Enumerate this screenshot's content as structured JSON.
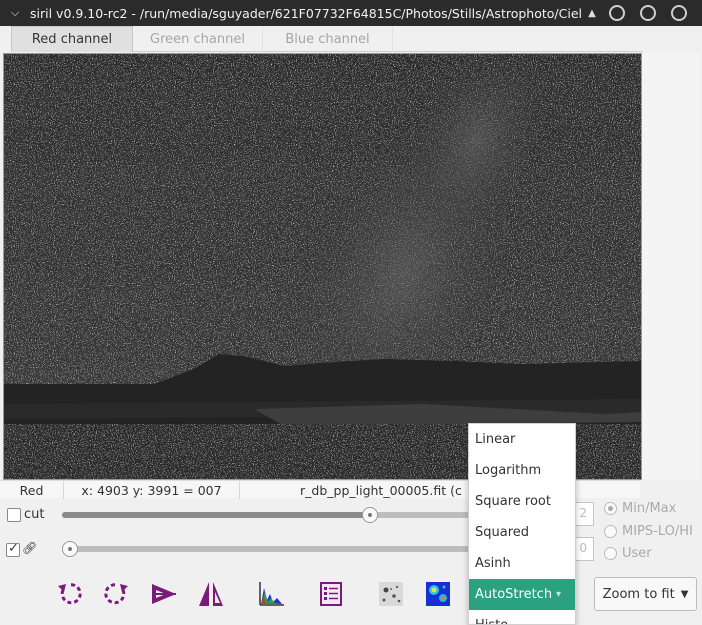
{
  "window": {
    "title": "siril v0.9.10-rc2 - /run/media/sguyader/621F07732F64815C/Photos/Stills/Astrophoto/Ciel_",
    "menu_icon": "chevron-down-icon",
    "up_icon": "chevron-up-icon"
  },
  "tabs": [
    {
      "label": "Red channel",
      "active": true
    },
    {
      "label": "Green channel",
      "active": false
    },
    {
      "label": "Blue channel",
      "active": false
    }
  ],
  "statusbar": {
    "channel": "Red",
    "coords": "x: 4903 y: 3991 = 007",
    "filename": "r_db_pp_light_00005.fit (c"
  },
  "levels_row": {
    "cut_checked": false,
    "cut_label": "cut",
    "hi_value": "2",
    "hi_slider_fraction": 0.67
  },
  "lo_row": {
    "link_checked": true,
    "link_icon": "link-icon",
    "lo_value": "0",
    "lo_slider_fraction": 0.0
  },
  "scale_mode": {
    "options": [
      "Min/Max",
      "MIPS-LO/HI",
      "User"
    ],
    "selected": "Min/Max"
  },
  "toolbar": [
    {
      "icon": "rotate-left-icon"
    },
    {
      "icon": "rotate-right-icon"
    },
    {
      "icon": "mirror-x-icon"
    },
    {
      "icon": "mirror-y-icon"
    },
    {
      "icon": "histogram-icon"
    },
    {
      "icon": "statistics-icon"
    },
    {
      "icon": "negative-view-icon"
    },
    {
      "icon": "color-map-icon"
    }
  ],
  "zoom_button": {
    "label": "Zoom to fit",
    "icon": "caret-down-icon"
  },
  "display_mode_menu": {
    "options": [
      "Linear",
      "Logarithm",
      "Square root",
      "Squared",
      "Asinh",
      "AutoStretch",
      "Histo"
    ],
    "selected": "AutoStretch"
  },
  "colors": {
    "accent": "#2aa17f",
    "icon_purple": "#7a1a7a",
    "titlebar": "#2b2b2b"
  }
}
